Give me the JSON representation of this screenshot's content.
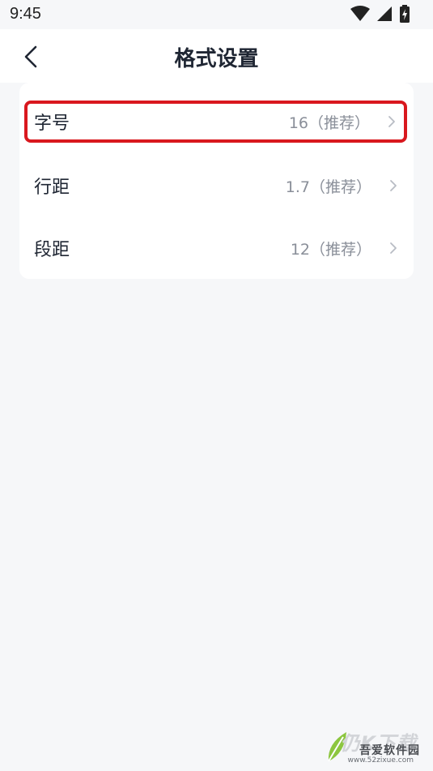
{
  "status_bar": {
    "time": "9:45",
    "icons": [
      "wifi-icon",
      "signal-icon",
      "battery-charging-icon"
    ]
  },
  "header": {
    "back_icon": "chevron-left-icon",
    "title": "格式设置"
  },
  "settings": [
    {
      "label": "字号",
      "value": "16（推荐）",
      "highlighted": true
    },
    {
      "label": "行距",
      "value": "1.7（推荐）",
      "highlighted": false
    },
    {
      "label": "段距",
      "value": "12（推荐）",
      "highlighted": false
    }
  ],
  "watermark": {
    "top": "仍K下载",
    "main": "吾爱软件园",
    "url": "www.52zixue.com"
  },
  "colors": {
    "highlight": "#d9181e",
    "background": "#f6f7f9",
    "card": "#ffffff"
  }
}
